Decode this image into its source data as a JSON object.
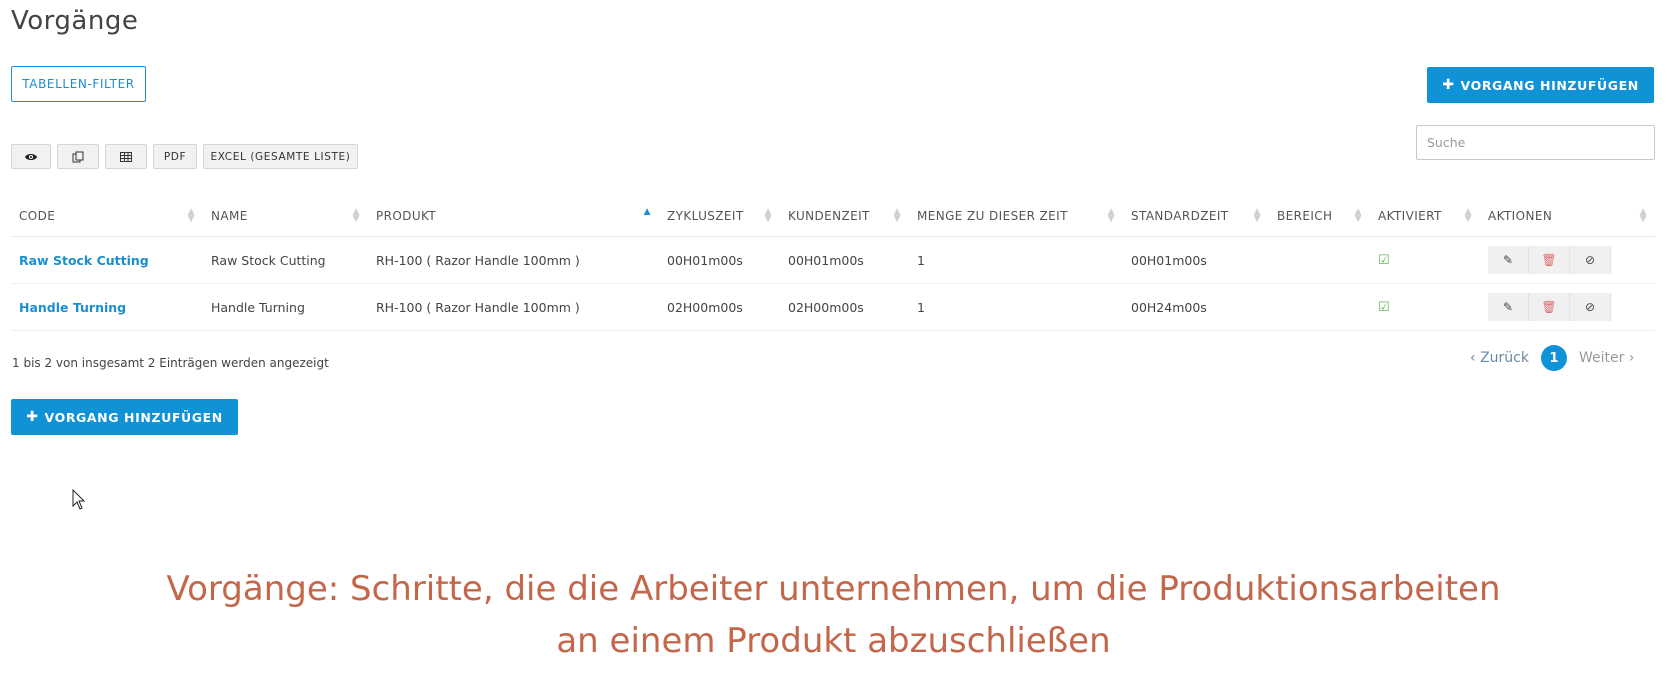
{
  "page": {
    "title": "Vorgänge"
  },
  "buttons": {
    "filter": "TABELLEN-FILTER",
    "add_top": "VORGANG HINZUFÜGEN",
    "add_bottom": "VORGANG HINZUFÜGEN",
    "plus_icon": "plus-icon"
  },
  "toolbar": {
    "view_icon": "eye-icon",
    "copy_icon": "copy-icon",
    "table_icon": "table-icon",
    "pdf": "PDF",
    "excel": "EXCEL (GESAMTE LISTE)"
  },
  "search": {
    "placeholder": "Suche",
    "value": ""
  },
  "table": {
    "headers": [
      "CODE",
      "NAME",
      "PRODUKT",
      "ZYKLUSZEIT",
      "KUNDENZEIT",
      "MENGE ZU DIESER ZEIT",
      "STANDARDZEIT",
      "BEREICH",
      "AKTIVIERT",
      "AKTIONEN"
    ],
    "sorted_column": "PRODUKT",
    "rows": [
      {
        "code": "Raw Stock Cutting",
        "name": "Raw Stock Cutting",
        "produkt": "RH-100 ( Razor Handle 100mm )",
        "zykluszeit": "00H01m00s",
        "kundenzeit": "00H01m00s",
        "menge": "1",
        "standardzeit": "00H01m00s",
        "bereich": "",
        "aktiviert": true
      },
      {
        "code": "Handle Turning",
        "name": "Handle Turning",
        "produkt": "RH-100 ( Razor Handle 100mm )",
        "zykluszeit": "02H00m00s",
        "kundenzeit": "02H00m00s",
        "menge": "1",
        "standardzeit": "00H24m00s",
        "bereich": "",
        "aktiviert": true
      }
    ],
    "action_icons": [
      "edit-icon",
      "trash-icon",
      "ban-icon"
    ]
  },
  "info": "1 bis 2 von insgesamt 2 Einträgen werden angezeigt",
  "pagination": {
    "prev": "Zurück",
    "current": "1",
    "next": "Weiter"
  },
  "caption": {
    "line1": "Vorgänge: Schritte, die die Arbeiter unternehmen, um die Produktionsarbeiten",
    "line2": "an einem Produkt abzuschließen"
  },
  "colors": {
    "accent": "#0f92d6",
    "caption": "#c4664a",
    "check": "#5cb85c"
  }
}
